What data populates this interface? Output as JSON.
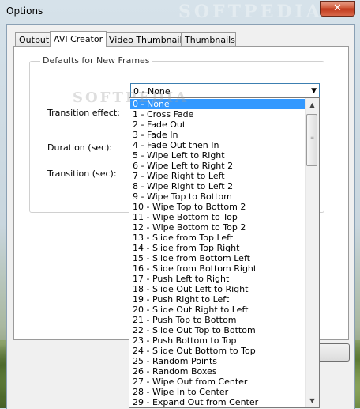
{
  "window": {
    "title": "Options",
    "close_glyph": "✕"
  },
  "watermark": "SOFTPEDIA",
  "tabs": [
    {
      "label": "Output",
      "active": false
    },
    {
      "label": "AVI Creator",
      "active": true
    },
    {
      "label": "Video Thumbnails",
      "active": false
    },
    {
      "label": "Thumbnails",
      "active": false
    }
  ],
  "group": {
    "legend": "Defaults for New Frames"
  },
  "fields": {
    "transition_effect_label": "Transition effect:",
    "duration_label": "Duration (sec):",
    "transition_label": "Transition (sec):",
    "transition_effect_value": "0 - None"
  },
  "dropdown": {
    "selected_index": 0,
    "options": [
      "0 - None",
      "1 - Cross Fade",
      "2 - Fade Out",
      "3 - Fade In",
      "4 - Fade Out then In",
      "5 - Wipe Left to Right",
      "6 - Wipe Left to Right 2",
      "7 - Wipe Right to Left",
      "8 - Wipe Right to Left 2",
      "9 - Wipe Top to Bottom",
      "10 - Wipe Top to Bottom 2",
      "11 - Wipe Bottom to Top",
      "12 - Wipe Bottom to Top 2",
      "13 - Slide from Top Left",
      "14 - Slide from Top Right",
      "15 - Slide from Bottom Left",
      "16 - Slide from Bottom Right",
      "17 - Push Left to Right",
      "18 - Slide Out Left to Right",
      "19 - Push Right to Left",
      "20 - Slide Out Right to Left",
      "21 - Push Top to Bottom",
      "22 - Slide Out Top to Bottom",
      "23 - Push Bottom to Top",
      "24 - Slide Out Bottom to Top",
      "25 - Random Points",
      "26 - Random Boxes",
      "27 - Wipe Out from Center",
      "28 - Wipe In to Center",
      "29 - Expand Out from Center"
    ]
  },
  "icons": {
    "dropdown_arrow": "chevron-down-icon",
    "scroll_up": "arrow-up-icon",
    "scroll_down": "arrow-down-icon"
  },
  "colors": {
    "selection": "#3399ff",
    "close_button": "#c0391c"
  }
}
